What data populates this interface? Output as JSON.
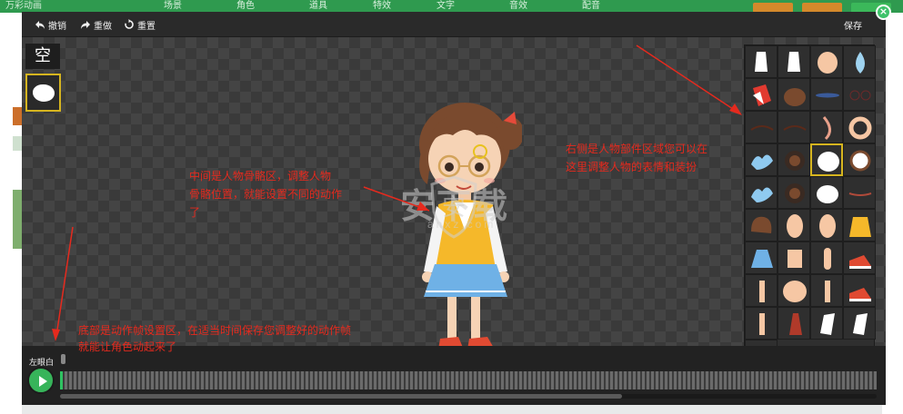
{
  "background_app": {
    "logo": "万彩动画",
    "nav": [
      "场景",
      "角色",
      "道具",
      "特效",
      "文字",
      "音效",
      "配音"
    ]
  },
  "toolbar": {
    "undo_label": "撤销",
    "redo_label": "重做",
    "reset_label": "重置",
    "save_label": "保存",
    "close_label": "×"
  },
  "expression": {
    "label": "空"
  },
  "annotations": {
    "middle_line1": "中间是人物骨骼区，调整人物",
    "middle_line2": "骨骼位置，就能设置不同的动作",
    "middle_line3": "了",
    "right_line1": "右侧是人物部件区域您可以在",
    "right_line2": "这里调整人物的表情和装扮",
    "bottom_line1": "底部是动作帧设置区，在适当时间保存您调整好的动作帧",
    "bottom_line2": "就能让角色动起来了"
  },
  "timeline": {
    "label": "左眼白"
  },
  "watermark": {
    "brand": "安下载",
    "domain": "anxz.com"
  },
  "colors": {
    "accent_green": "#3ec26a",
    "selection_yellow": "#d6b51f",
    "annotation_red": "#e52a1e"
  },
  "parts_panel": {
    "items": [
      "hand-glove",
      "hand-glove",
      "hand",
      "drop",
      "sleeve-red",
      "hair",
      "brow-blue",
      "glasses-thin",
      "brow-dark",
      "brow-dark",
      "nose",
      "ring",
      "splash",
      "eye-brown",
      "eye-white-blob",
      "mouth-ring",
      "splash",
      "eye-brown",
      "eye-white",
      "mouth-line",
      "hair-short",
      "ear",
      "ear",
      "shirt-yellow",
      "skirt-blue",
      "neck",
      "arm",
      "shoe-red",
      "leg",
      "torso",
      "leg",
      "shoe-red",
      "leg",
      "tie-red",
      "sleeve-white",
      "sleeve-white",
      "foot"
    ],
    "selected_index": 14
  }
}
